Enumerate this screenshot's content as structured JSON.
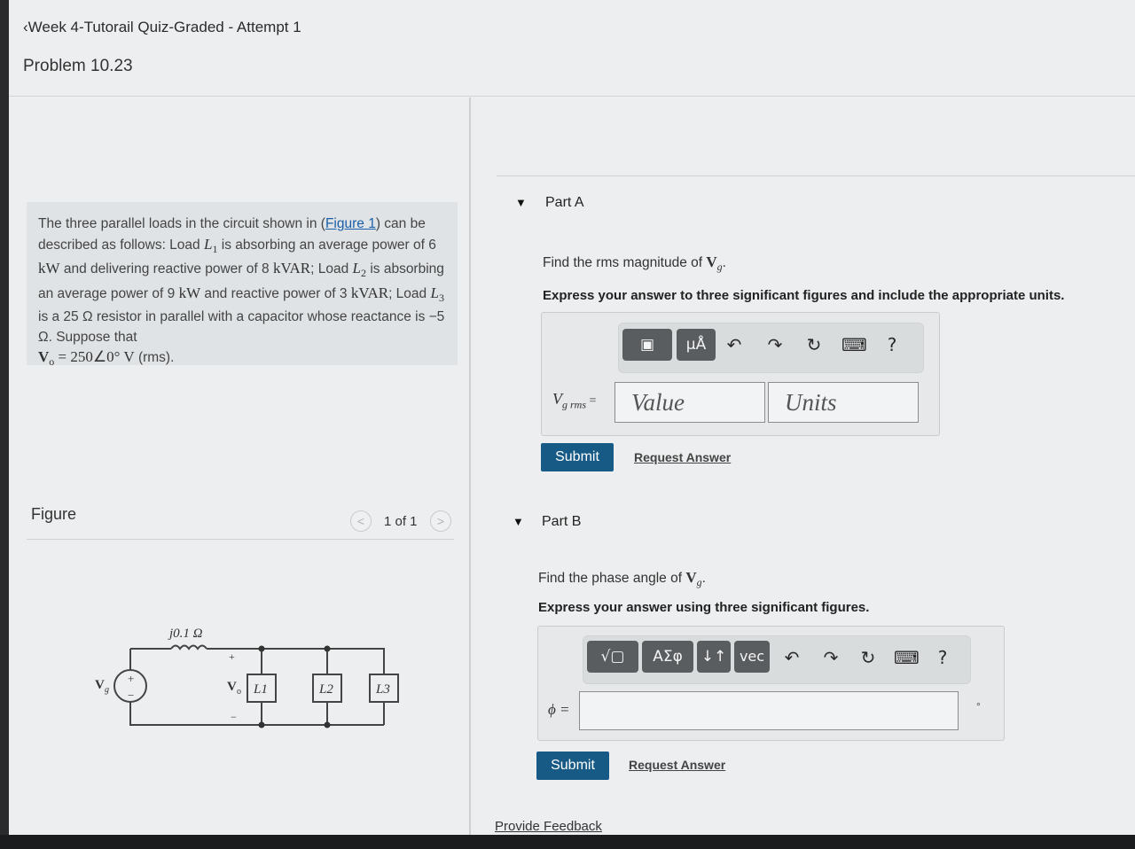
{
  "header": {
    "back_label": "Week 4-Tutorail Quiz-Graded - Attempt 1",
    "problem_title": "Problem 10.23"
  },
  "problem": {
    "t1": "The three parallel loads in the circuit shown in (",
    "figure_link": "Figure 1",
    "t2": ") can be described as follows: Load ",
    "L1": "L",
    "L1sub": "1",
    "t3": " is absorbing an average power of 6 ",
    "kW": "kW",
    "t4": " and delivering reactive power of 8 ",
    "kVAR": "kVAR",
    "t5": "; Load ",
    "L2": "L",
    "L2sub": "2",
    "t6": " is absorbing an average power of 9 ",
    "kW2": "kW",
    "t7": " and reactive power of 3 ",
    "kVAR2": "kVAR",
    "t8": "; Load ",
    "L3": "L",
    "L3sub": "3",
    "t9": " is a 25 Ω resistor in parallel with a capacitor whose reactance is −5 Ω. Suppose that",
    "vo_eq": "V",
    "vo_sub": "o",
    "vo_val": " = 250∠0° V",
    "vo_rms": " (rms)."
  },
  "figure": {
    "label": "Figure",
    "page_count": "1 of 1",
    "prev_glyph": "<",
    "next_glyph": ">",
    "inductor_label": "j0.1 Ω",
    "vg_label": "V",
    "vg_sub": "g",
    "vo_label": "V",
    "vo_sub": "o",
    "plus": "+",
    "minus": "−",
    "loads": [
      "L1",
      "L2",
      "L3"
    ]
  },
  "partA": {
    "title": "Part A",
    "question_pre": "Find the rms magnitude of ",
    "question_var": "V",
    "question_sub": "g",
    "question_post": ".",
    "instruction": "Express your answer to three significant figures and include the appropriate units.",
    "toolbar": [
      "▣",
      "μÅ",
      "↶",
      "↷",
      "↻",
      "⌨",
      "?"
    ],
    "var_label": "V",
    "var_sub": "g rms",
    "var_eq": " =",
    "value_placeholder": "Value",
    "units_placeholder": "Units",
    "submit": "Submit",
    "request": "Request Answer"
  },
  "partB": {
    "title": "Part B",
    "question_pre": "Find the phase angle of ",
    "question_var": "V",
    "question_sub": "g",
    "question_post": ".",
    "instruction": "Express your answer using three significant figures.",
    "toolbar": [
      "√▢",
      "ΑΣφ",
      "↓↑",
      "vec",
      "↶",
      "↷",
      "↻",
      "⌨",
      "?"
    ],
    "var_label": "ϕ =",
    "unit": "°",
    "submit": "Submit",
    "request": "Request Answer"
  },
  "footer": {
    "feedback": "Provide Feedback"
  }
}
